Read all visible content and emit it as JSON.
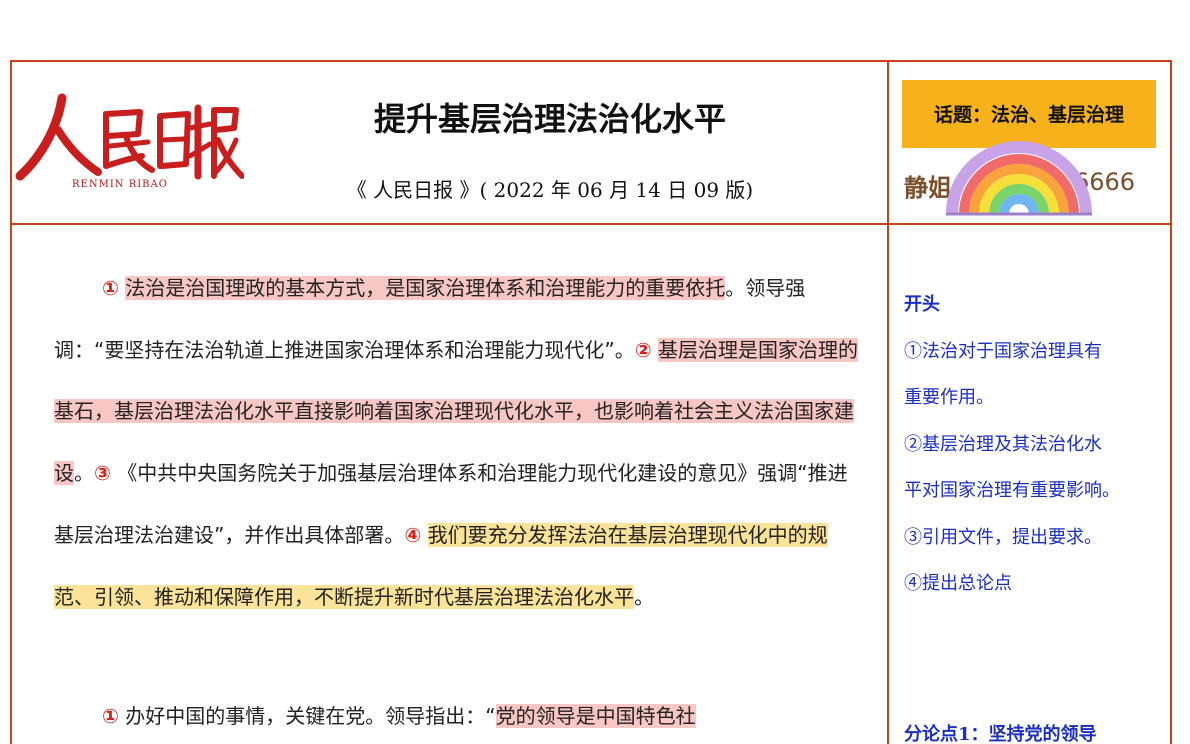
{
  "logo": {
    "text": "人民日报",
    "subtitle": "RENMIN RIBAO"
  },
  "article": {
    "title": "提升基层治理法治化水平",
    "source": "《 人民日报 》( 2022 年 06 月 14 日 09 版)"
  },
  "sidebar": {
    "topic": "话题：法治、基层治理",
    "author_prefix": "静姐",
    "author_suffix": "6666",
    "sticker_icon": "rainbow-icon"
  },
  "paragraph1": {
    "n1": "①",
    "s1": "法治是治国理政的基本方式，是国家治理体系和治理能力的重要依托",
    "s1b": "。领导强调：“要坚持在法治轨道上推进国家治理体系和治理能力现代化”。",
    "n2": "②",
    "s2": "基层治理是国家治理的基石，基层治理法治化水平直接影响着国家治理现代化水平，也影响着社会主义法治国家建设",
    "s2b": "。",
    "n3": "③",
    "s3": "《中共中央国务院关于加强基层治理体系和治理能力现代化建设的意见》强调“推进基层治理法治建设”，并作出具体部署。",
    "n4": "④",
    "s4": "我们要充分发挥法治在基层治理现代化中的规范、引领、推动和保障作用，不断提升新时代基层治理法治化水平",
    "s4b": "。"
  },
  "paragraph2": {
    "n1": "①",
    "s1": "办好中国的事情，关键在党。领导指出：“",
    "s1h": "党的领导是中国特色社"
  },
  "outline": {
    "head": "开头",
    "lines": [
      "①法治对于国家治理具有",
      "重要作用。",
      "②基层治理及其法治化水",
      "平对国家治理有重要影响。",
      "③引用文件，提出要求。",
      "④提出总论点"
    ],
    "point1": "分论点1：坚持党的领导"
  },
  "colors": {
    "border": "#c9411c",
    "highlight_red": "#f8c6c3",
    "highlight_yellow": "#fbe39a",
    "number_red": "#d8221a",
    "outline_blue": "#1a2ec2",
    "topic_bg": "#f7b21b"
  }
}
